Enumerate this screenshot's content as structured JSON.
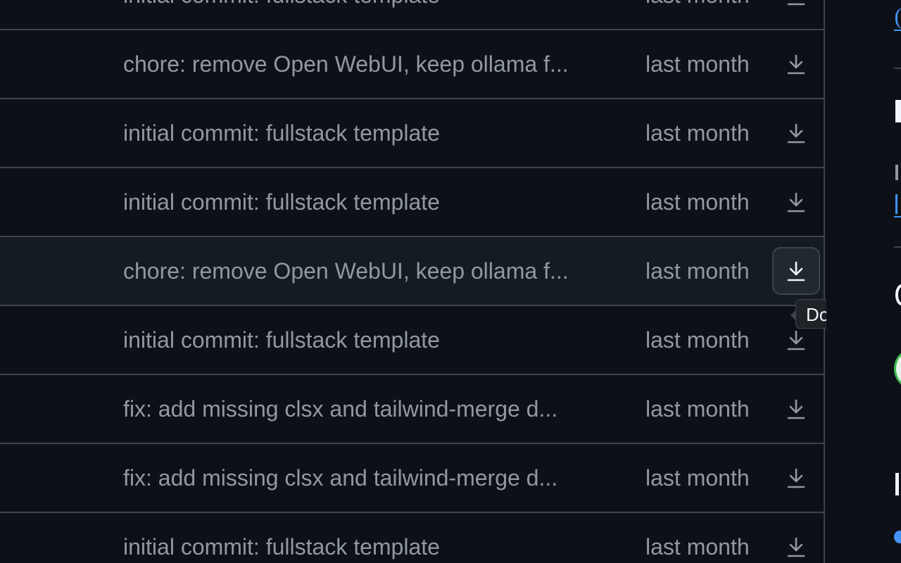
{
  "rows": [
    {
      "message": "initial commit: fullstack template",
      "date": "last month"
    },
    {
      "message": "chore: remove Open WebUI, keep ollama f...",
      "date": "last month"
    },
    {
      "message": "initial commit: fullstack template",
      "date": "last month"
    },
    {
      "message": "initial commit: fullstack template",
      "date": "last month"
    },
    {
      "message": "chore: remove Open WebUI, keep ollama f...",
      "date": "last month"
    },
    {
      "message": "initial commit: fullstack template",
      "date": "last month"
    },
    {
      "message": "fix: add missing clsx and tailwind-merge d...",
      "date": "last month"
    },
    {
      "message": "fix: add missing clsx and tailwind-merge d...",
      "date": "last month"
    },
    {
      "message": "initial commit: fullstack template",
      "date": "last month"
    }
  ],
  "hovered_row_index": 4,
  "download_icon": "download-icon",
  "tooltip": {
    "text": "Download"
  },
  "colors": {
    "background": "#0d1117",
    "border": "#3d444d",
    "muted_text": "#9198a1",
    "hover_row": "#151b23",
    "accent": "#4493f8"
  }
}
